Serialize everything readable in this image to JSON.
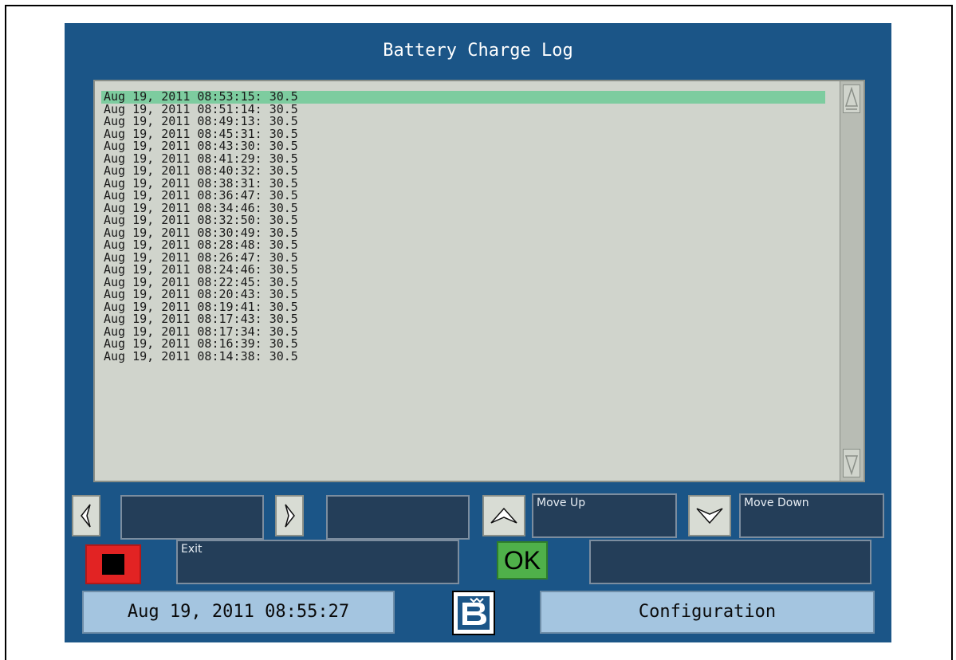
{
  "window": {
    "title": "Battery Charge Log"
  },
  "log": {
    "entries": [
      "Aug 19, 2011 08:53:15: 30.5",
      "Aug 19, 2011 08:51:14: 30.5",
      "Aug 19, 2011 08:49:13: 30.5",
      "Aug 19, 2011 08:45:31: 30.5",
      "Aug 19, 2011 08:43:30: 30.5",
      "Aug 19, 2011 08:41:29: 30.5",
      "Aug 19, 2011 08:40:32: 30.5",
      "Aug 19, 2011 08:38:31: 30.5",
      "Aug 19, 2011 08:36:47: 30.5",
      "Aug 19, 2011 08:34:46: 30.5",
      "Aug 19, 2011 08:32:50: 30.5",
      "Aug 19, 2011 08:30:49: 30.5",
      "Aug 19, 2011 08:28:48: 30.5",
      "Aug 19, 2011 08:26:47: 30.5",
      "Aug 19, 2011 08:24:46: 30.5",
      "Aug 19, 2011 08:22:45: 30.5",
      "Aug 19, 2011 08:20:43: 30.5",
      "Aug 19, 2011 08:19:41: 30.5",
      "Aug 19, 2011 08:17:43: 30.5",
      "Aug 19, 2011 08:17:34: 30.5",
      "Aug 19, 2011 08:16:39: 30.5",
      "Aug 19, 2011 08:14:38: 30.5"
    ],
    "selected_index": 0
  },
  "controls": {
    "left_field": "",
    "right_field": "",
    "move_up_label": "Move Up",
    "move_down_label": "Move Down",
    "exit_label": "Exit",
    "ok_label": "OK",
    "ok_field": ""
  },
  "footer": {
    "datetime": "Aug 19, 2011 08:55:27",
    "configuration_label": "Configuration"
  },
  "colors": {
    "screen_bg": "#1b5587",
    "list_bg": "#d0d4cc",
    "selected_row": "#7dcc9f",
    "stop_red": "#e22323",
    "ok_green": "#4fb04a",
    "footer_button": "#a4c5e0"
  },
  "icons": {
    "left": "arrow-left-icon",
    "right": "arrow-right-icon",
    "up": "move-up-icon",
    "down": "move-down-icon",
    "stop": "stop-icon",
    "logo": "brand-logo-icon"
  }
}
